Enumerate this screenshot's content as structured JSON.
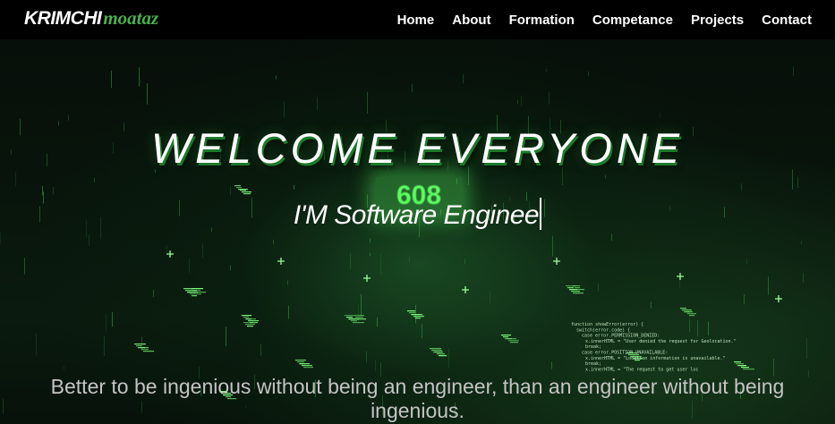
{
  "navbar": {
    "logo_main": "KRIMCHI",
    "logo_sub": "moataz",
    "links": [
      "Home",
      "About",
      "Formation",
      "Competance",
      "Projects",
      "Contact"
    ]
  },
  "hero": {
    "title": "WELCOME EVERYONE",
    "counter": "608",
    "typing_text": "I'M Software Enginee",
    "quote": "Better to be ingenious without being an engineer, than an engineer without being ingenious."
  },
  "code_snippet": [
    "function showError(error) {",
    "switch(error.code) {",
    "case error.PERMISSION_DENIED:",
    "x.innerHTML = \"User denied the request for Geolocation.\"",
    "break;",
    "case error.POSITION_UNAVAILABLE:",
    "x.innerHTML = \"Location information is unavailable.\"",
    "break;",
    "x.innerHTML = \"The request to get user loc"
  ],
  "colors": {
    "accent": "#4caf50",
    "navbar_bg": "#000000",
    "glow": "#5dff62"
  }
}
